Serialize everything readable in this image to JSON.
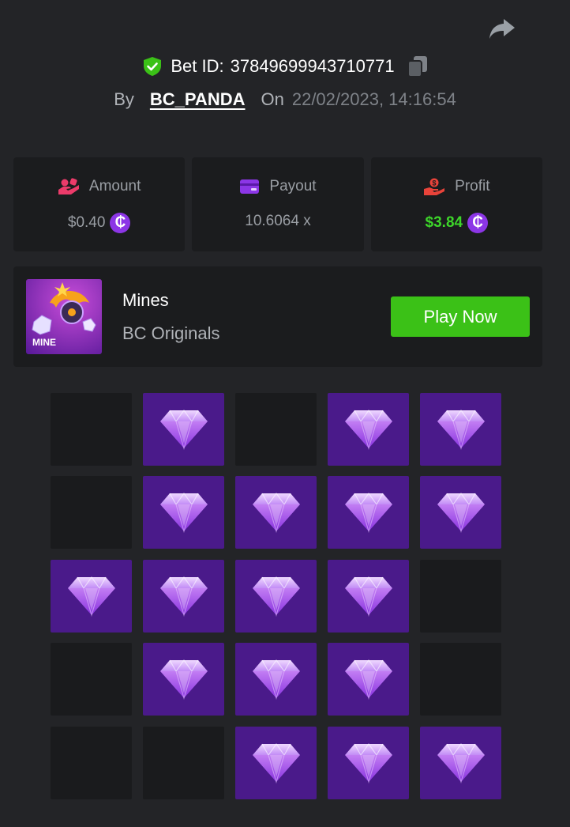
{
  "header": {
    "share_icon": "share-forward-icon",
    "bet_label": "Bet ID:",
    "bet_id": "37849699943710771",
    "verified_icon": "shield-check-icon",
    "copy_icon": "copy-icon",
    "by_label": "By",
    "username": "BC_PANDA",
    "on_label": "On",
    "datetime": "22/02/2023, 14:16:54"
  },
  "stats": {
    "amount": {
      "label": "Amount",
      "value": "$0.40",
      "icon": "hand-coins-icon",
      "currency_symbol": "₵"
    },
    "payout": {
      "label": "Payout",
      "value": "10.6064 x",
      "icon": "wallet-card-icon"
    },
    "profit": {
      "label": "Profit",
      "value": "$3.84",
      "icon": "hand-money-icon",
      "currency_symbol": "₵"
    }
  },
  "game": {
    "thumb_text": "MINE",
    "title": "Mines",
    "provider": "BC Originals",
    "play_label": "Play Now"
  },
  "colors": {
    "accent_green": "#3bc117",
    "profit_green": "#3dd52a",
    "gem_tile": "#4a1a8a",
    "coin_purple": "#8c36e6",
    "background": "#232427",
    "card": "#1b1c1e"
  },
  "mines_grid": {
    "rows": 5,
    "cols": 5,
    "cells": [
      [
        "empty",
        "gem",
        "empty",
        "gem",
        "gem"
      ],
      [
        "empty",
        "gem",
        "gem",
        "gem",
        "gem"
      ],
      [
        "gem",
        "gem",
        "gem",
        "gem",
        "empty"
      ],
      [
        "empty",
        "gem",
        "gem",
        "gem",
        "empty"
      ],
      [
        "empty",
        "empty",
        "gem",
        "gem",
        "gem"
      ]
    ]
  }
}
